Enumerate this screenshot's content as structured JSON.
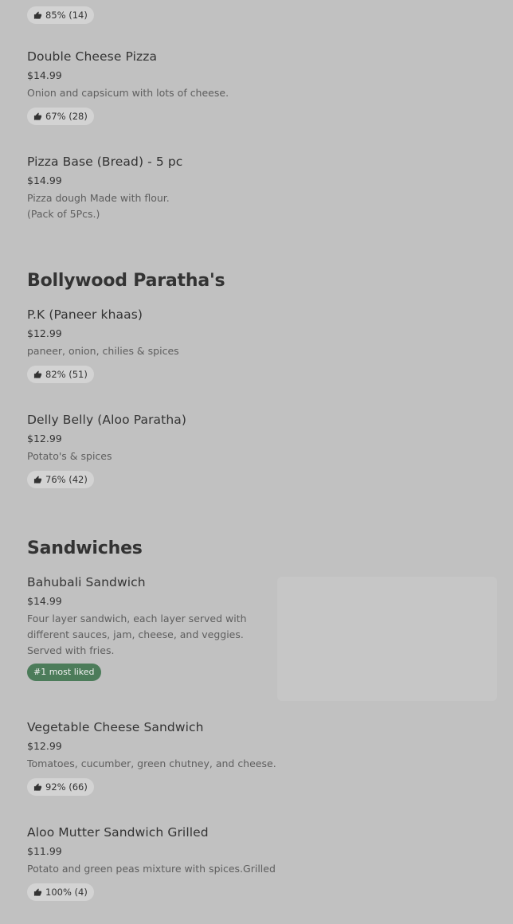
{
  "top_item": {
    "rating": "85% (14)"
  },
  "pizza": {
    "items": [
      {
        "name": "Double Cheese Pizza",
        "price": "$14.99",
        "desc": "Onion and capsicum with lots of cheese.",
        "rating": "67% (28)"
      },
      {
        "name": "Pizza Base (Bread) - 5 pc",
        "price": "$14.99",
        "desc_line1": "Pizza dough Made with flour.",
        "desc_line2": "(Pack of 5Pcs.)"
      }
    ]
  },
  "paratha": {
    "title": "Bollywood Paratha's",
    "items": [
      {
        "name": "P.K (Paneer khaas)",
        "price": "$12.99",
        "desc": "paneer, onion, chilies & spices",
        "rating": "82% (51)"
      },
      {
        "name": "Delly Belly (Aloo Paratha)",
        "price": "$12.99",
        "desc": "Potato's & spices",
        "rating": "76% (42)"
      }
    ]
  },
  "sandwiches": {
    "title": "Sandwiches",
    "items": [
      {
        "name": "Bahubali Sandwich",
        "price": "$14.99",
        "desc_line1": "Four layer sandwich, each layer served with",
        "desc_line2": "different sauces, jam, cheese, and veggies.",
        "desc_line3": "Served with fries.",
        "badge": "#1 most liked"
      },
      {
        "name": "Vegetable Cheese Sandwich",
        "price": "$12.99",
        "desc": "Tomatoes, cucumber, green chutney, and cheese.",
        "rating": "92% (66)"
      },
      {
        "name": "Aloo Mutter Sandwich Grilled",
        "price": "$11.99",
        "desc": "Potato and green peas mixture with spices.Grilled",
        "rating": "100% (4)"
      }
    ]
  },
  "icons": {
    "rating": "thumbs-up-icon"
  }
}
